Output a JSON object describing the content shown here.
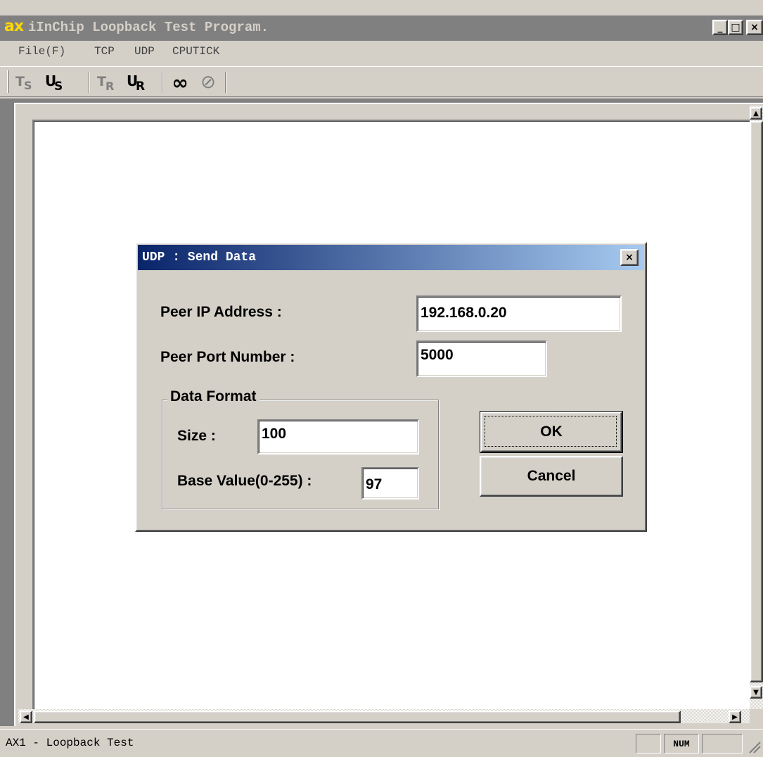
{
  "window": {
    "logo": "ax",
    "title": "iInChip Loopback Test Program.",
    "minimize_label": "_",
    "maximize_label": "□",
    "close_label": "×"
  },
  "menu": {
    "items": [
      "File(F)",
      "TCP",
      "UDP",
      "CPUTICK"
    ]
  },
  "toolbar": {
    "buttons": [
      {
        "icon": "tcp-send-icon",
        "glyph": "TS"
      },
      {
        "icon": "udp-send-icon",
        "glyph": "US"
      },
      {
        "icon": "tcp-receive-icon",
        "glyph": "TR"
      },
      {
        "icon": "udp-receive-icon",
        "glyph": "UR"
      },
      {
        "icon": "loop-icon",
        "glyph": "∞"
      },
      {
        "icon": "stop-icon",
        "glyph": "⊘"
      }
    ]
  },
  "dialog": {
    "title": "UDP : Send Data",
    "close_label": "×",
    "peer_ip_label": "Peer IP Address :",
    "peer_ip_value": "192.168.0.20",
    "peer_port_label": "Peer Port Number :",
    "peer_port_value": "5000",
    "data_format_label": "Data Format",
    "size_label": "Size :",
    "size_value": "100",
    "base_value_label": "Base Value(0-255) :",
    "base_value_value": "97",
    "ok_label": "OK",
    "cancel_label": "Cancel"
  },
  "statusbar": {
    "text": "AX1 - Loopback Test",
    "num_indicator": "NUM"
  }
}
